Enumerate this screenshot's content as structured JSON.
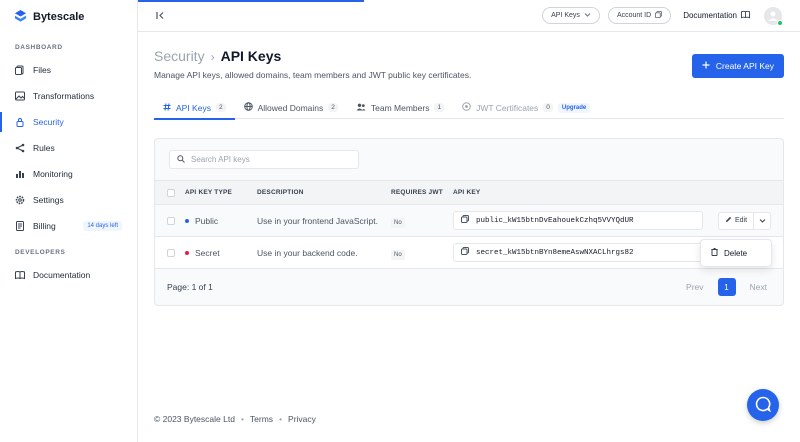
{
  "brand": {
    "name": "Bytescale",
    "color": "#2563eb"
  },
  "sidebar": {
    "sections": [
      {
        "label": "DASHBOARD"
      },
      {
        "label": "DEVELOPERS"
      }
    ],
    "items": [
      {
        "label": "Files",
        "icon": "files-icon"
      },
      {
        "label": "Transformations",
        "icon": "image-icon"
      },
      {
        "label": "Security",
        "icon": "lock-icon",
        "active": true
      },
      {
        "label": "Rules",
        "icon": "share-icon"
      },
      {
        "label": "Monitoring",
        "icon": "bar-chart-icon"
      },
      {
        "label": "Settings",
        "icon": "gear-icon"
      },
      {
        "label": "Billing",
        "icon": "receipt-icon",
        "badge": "14 days left"
      },
      {
        "label": "Documentation",
        "icon": "book-icon"
      }
    ]
  },
  "topbar": {
    "api_keys_select": "API Keys",
    "account_id": "Account ID",
    "documentation": "Documentation"
  },
  "page": {
    "breadcrumb_parent": "Security",
    "breadcrumb_current": "API Keys",
    "subtitle": "Manage API keys, allowed domains, team members and JWT public key certificates.",
    "create_button": "Create API Key"
  },
  "tabs": [
    {
      "label": "API Keys",
      "count": "2",
      "icon": "hash-icon",
      "active": true
    },
    {
      "label": "Allowed Domains",
      "count": "2",
      "icon": "globe-icon"
    },
    {
      "label": "Team Members",
      "count": "1",
      "icon": "users-icon"
    },
    {
      "label": "JWT Certificates",
      "count": "0",
      "icon": "certificate-icon",
      "badge": "Upgrade"
    }
  ],
  "search": {
    "placeholder": "Search API keys",
    "value": ""
  },
  "table": {
    "headers": [
      "API KEY TYPE",
      "DESCRIPTION",
      "REQUIRES JWT",
      "API KEY"
    ],
    "rows": [
      {
        "type": "Public",
        "dot_color": "#2563eb",
        "description": "Use in your frontend JavaScript.",
        "requires_jwt": "No",
        "key": "public_kW15btnDvEahouekCzhq5VVYQdUR"
      },
      {
        "type": "Secret",
        "dot_color": "#e11d48",
        "description": "Use in your backend code.",
        "requires_jwt": "No",
        "key": "secret_kW15btnBYn8emeAswNXACLhrgs82"
      }
    ],
    "edit_label": "Edit"
  },
  "row_menu": {
    "delete_label": "Delete"
  },
  "pagination": {
    "summary": "Page: 1 of 1",
    "prev": "Prev",
    "current": "1",
    "next": "Next"
  },
  "footer": {
    "copyright": "© 2023 Bytescale Ltd",
    "terms": "Terms",
    "privacy": "Privacy",
    "separator": "•"
  }
}
